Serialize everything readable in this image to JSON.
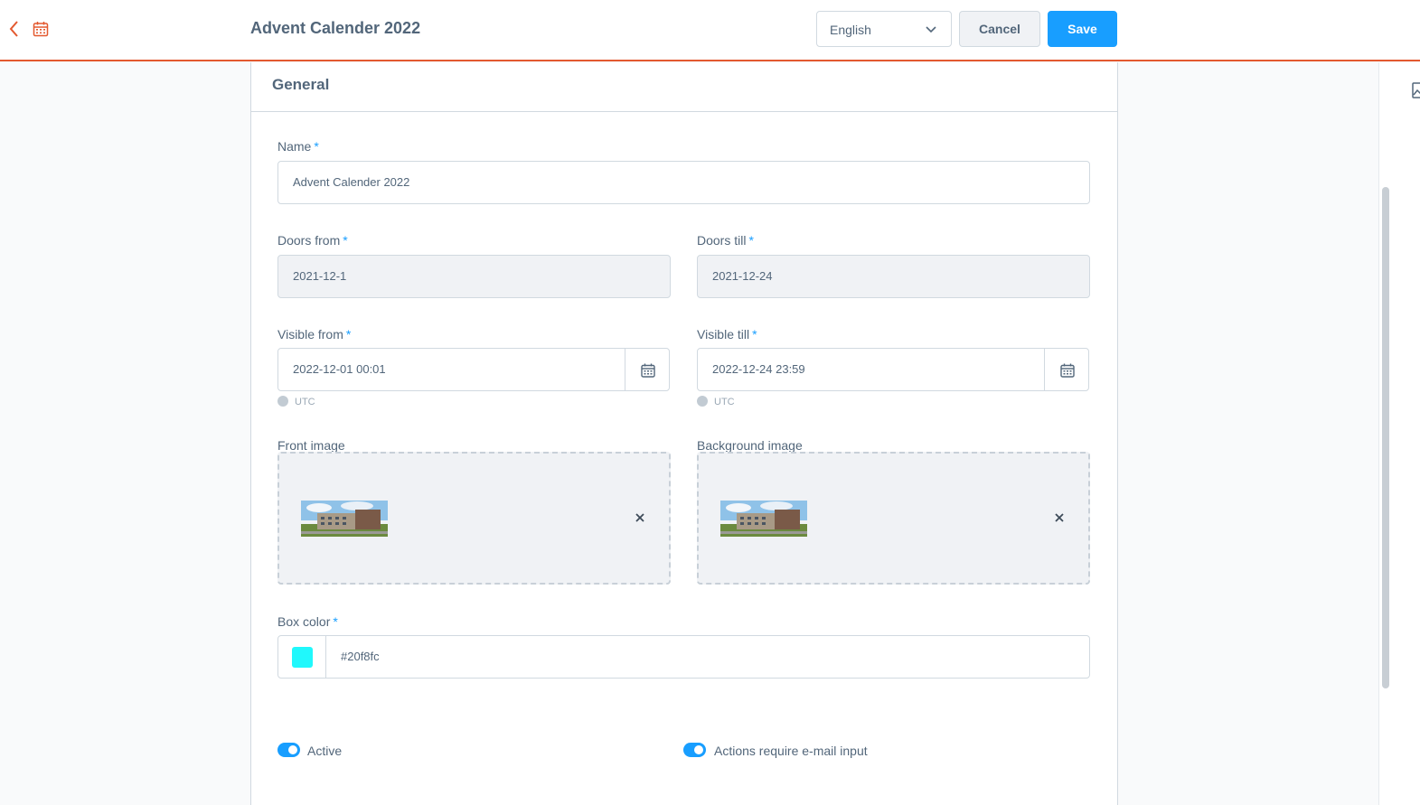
{
  "header": {
    "title": "Advent Calender 2022",
    "language": "English",
    "cancel_label": "Cancel",
    "save_label": "Save"
  },
  "card": {
    "title": "General"
  },
  "form": {
    "name": {
      "label": "Name",
      "value": "Advent Calender 2022"
    },
    "doors_from": {
      "label": "Doors from",
      "value": "2021-12-1"
    },
    "doors_till": {
      "label": "Doors till",
      "value": "2021-12-24"
    },
    "visible_from": {
      "label": "Visible from",
      "value": "2022-12-01 00:01",
      "timezone": "UTC"
    },
    "visible_till": {
      "label": "Visible till",
      "value": "2022-12-24 23:59",
      "timezone": "UTC"
    },
    "front_image": {
      "label": "Front image"
    },
    "background_image": {
      "label": "Background image"
    },
    "box_color": {
      "label": "Box color",
      "value": "#20f8fc"
    },
    "active": {
      "label": "Active",
      "on": true
    },
    "require_email": {
      "label": "Actions require e-mail input",
      "on": true
    },
    "required_marker": "*"
  },
  "colors": {
    "accent": "#189eff",
    "topbar_border": "#e3592f",
    "swatch": "#20f8fc"
  },
  "icons": {
    "back": "chevron-left-icon",
    "calendar": "calendar-icon",
    "dropdown": "chevron-down-icon",
    "remove": "close-icon",
    "clock": "clock-icon"
  }
}
